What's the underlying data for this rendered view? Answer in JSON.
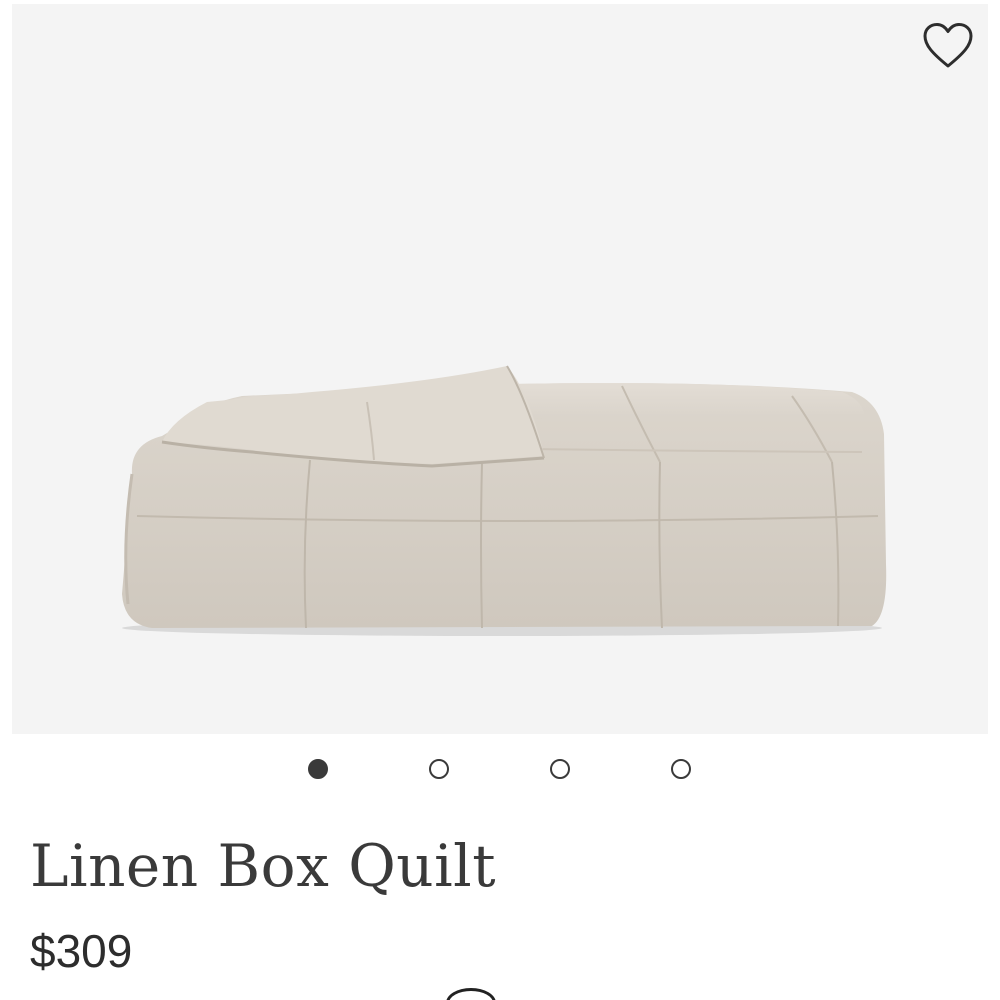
{
  "product": {
    "title": "Linen Box Quilt",
    "price": "$309",
    "image_alt": "Linen Box Quilt folded, natural linen color"
  },
  "gallery": {
    "slide_count": 4,
    "active_slide": 1
  },
  "icons": {
    "favorite": "heart-outline-icon"
  },
  "colors": {
    "image_background": "#f4f4f4",
    "quilt_fabric": "#d6d0c7",
    "text_primary": "#3a3a3a",
    "dot_active": "#3a3a3a"
  }
}
